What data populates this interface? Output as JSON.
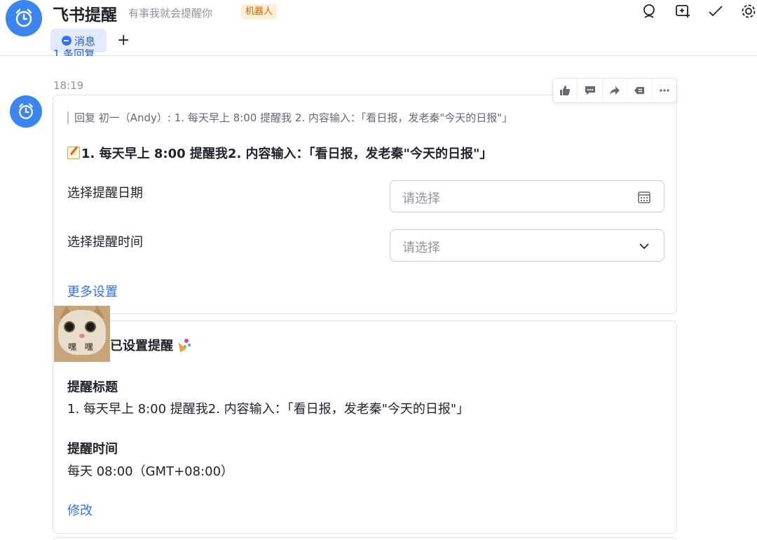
{
  "header": {
    "title": "飞书提醒",
    "subtitle": "有事我就会提醒你",
    "bot_tag": "机器人",
    "tab_label": "消息",
    "add_tab": "+",
    "reply_peek": "1 条回复",
    "tools": [
      "search-icon",
      "add-chat-icon",
      "done-icon",
      "settings-icon"
    ]
  },
  "message": {
    "time": "18:19",
    "toolbar": [
      "thumbs-up-icon",
      "comment-icon",
      "forward-icon",
      "more-reply-icon",
      "more-icon"
    ],
    "quote": "回复 初一（Andy）: 1. 每天早上 8:00 提醒我 2. 内容输入：「看日报，发老秦\"今天的日报\"」",
    "card_title": "1. 每天早上 8:00 提醒我2. 内容输入：「看日报，发老秦\"今天的日报\"」",
    "date_label": "选择提醒日期",
    "date_placeholder": "请选择",
    "time_label": "选择提醒时间",
    "time_placeholder": "请选择",
    "more_settings": "更多设置"
  },
  "confirmation": {
    "sticker_caption": "嘿 嘿",
    "title": "已设置提醒",
    "reminder_title_label": "提醒标题",
    "reminder_title_value": "1. 每天早上 8:00 提醒我2. 内容输入：「看日报，发老秦\"今天的日报\"」",
    "reminder_time_label": "提醒时间",
    "reminder_time_value": "每天 08:00（GMT+08:00）",
    "edit_link": "修改"
  },
  "colors": {
    "accent": "#3370ff",
    "avatar": "#3a85f0",
    "bot_tag_bg": "#fdf0d5",
    "bot_tag_text": "#d25f00"
  }
}
